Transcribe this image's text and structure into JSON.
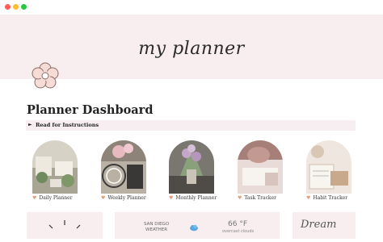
{
  "window": {
    "controls": [
      "close",
      "minimize",
      "zoom"
    ]
  },
  "cover": {
    "title": "my planner"
  },
  "page": {
    "icon": "flower-icon",
    "title": "Planner Dashboard"
  },
  "toggle": {
    "label": "Read for Instructions"
  },
  "planners": [
    {
      "label": "Daily Planner",
      "icon": "heart-icon"
    },
    {
      "label": "Weekly Planner",
      "icon": "heart-icon"
    },
    {
      "label": "Monthly Planner",
      "icon": "heart-icon"
    },
    {
      "label": "Task Tracker",
      "icon": "heart-icon"
    },
    {
      "label": "Habit Tracker",
      "icon": "heart-icon"
    }
  ],
  "weather": {
    "city": "SAN DIEGO",
    "label": "WEATHER",
    "temperature": "66 °F",
    "condition": "overcast clouds",
    "icon": "cloud-icon"
  },
  "quote_widget": {
    "text": "Dream"
  },
  "colors": {
    "accent": "#f8eeef",
    "heart": "#e0a07a"
  }
}
